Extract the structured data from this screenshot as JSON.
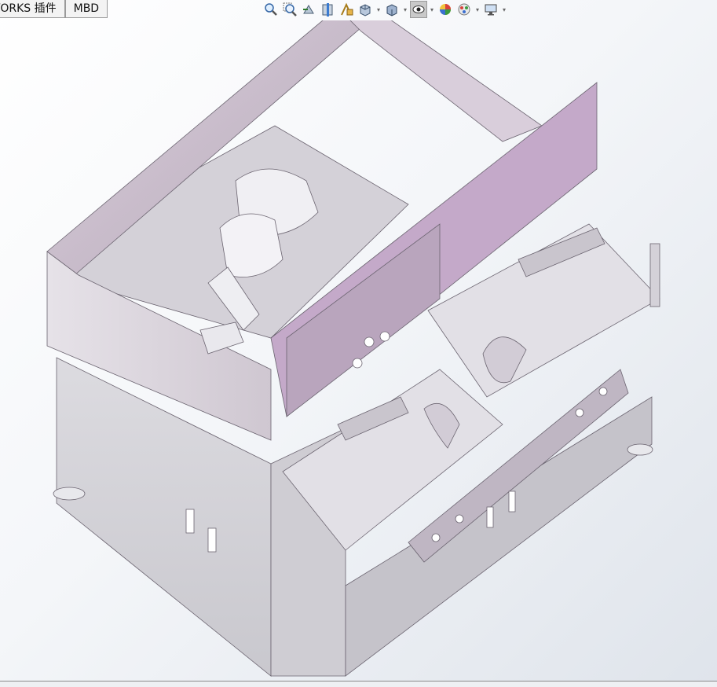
{
  "tabs": [
    {
      "label": "VORKS 插件"
    },
    {
      "label": "MBD"
    }
  ],
  "toolbar": {
    "icons": [
      "zoom-to-fit-icon",
      "zoom-to-area-icon",
      "previous-view-icon",
      "section-view-icon",
      "dynamic-annotation-icon",
      "view-orientation-icon",
      "display-style-icon",
      "hide-show-items-icon",
      "edit-appearance-icon",
      "apply-scene-icon",
      "view-settings-icon"
    ]
  },
  "model": {
    "description_colors": {
      "frame": "#c9bccb",
      "frame_dark": "#a99cab",
      "panel": "#e3dde4",
      "body": "#d8d7db",
      "accent": "#c4a9c9"
    }
  }
}
